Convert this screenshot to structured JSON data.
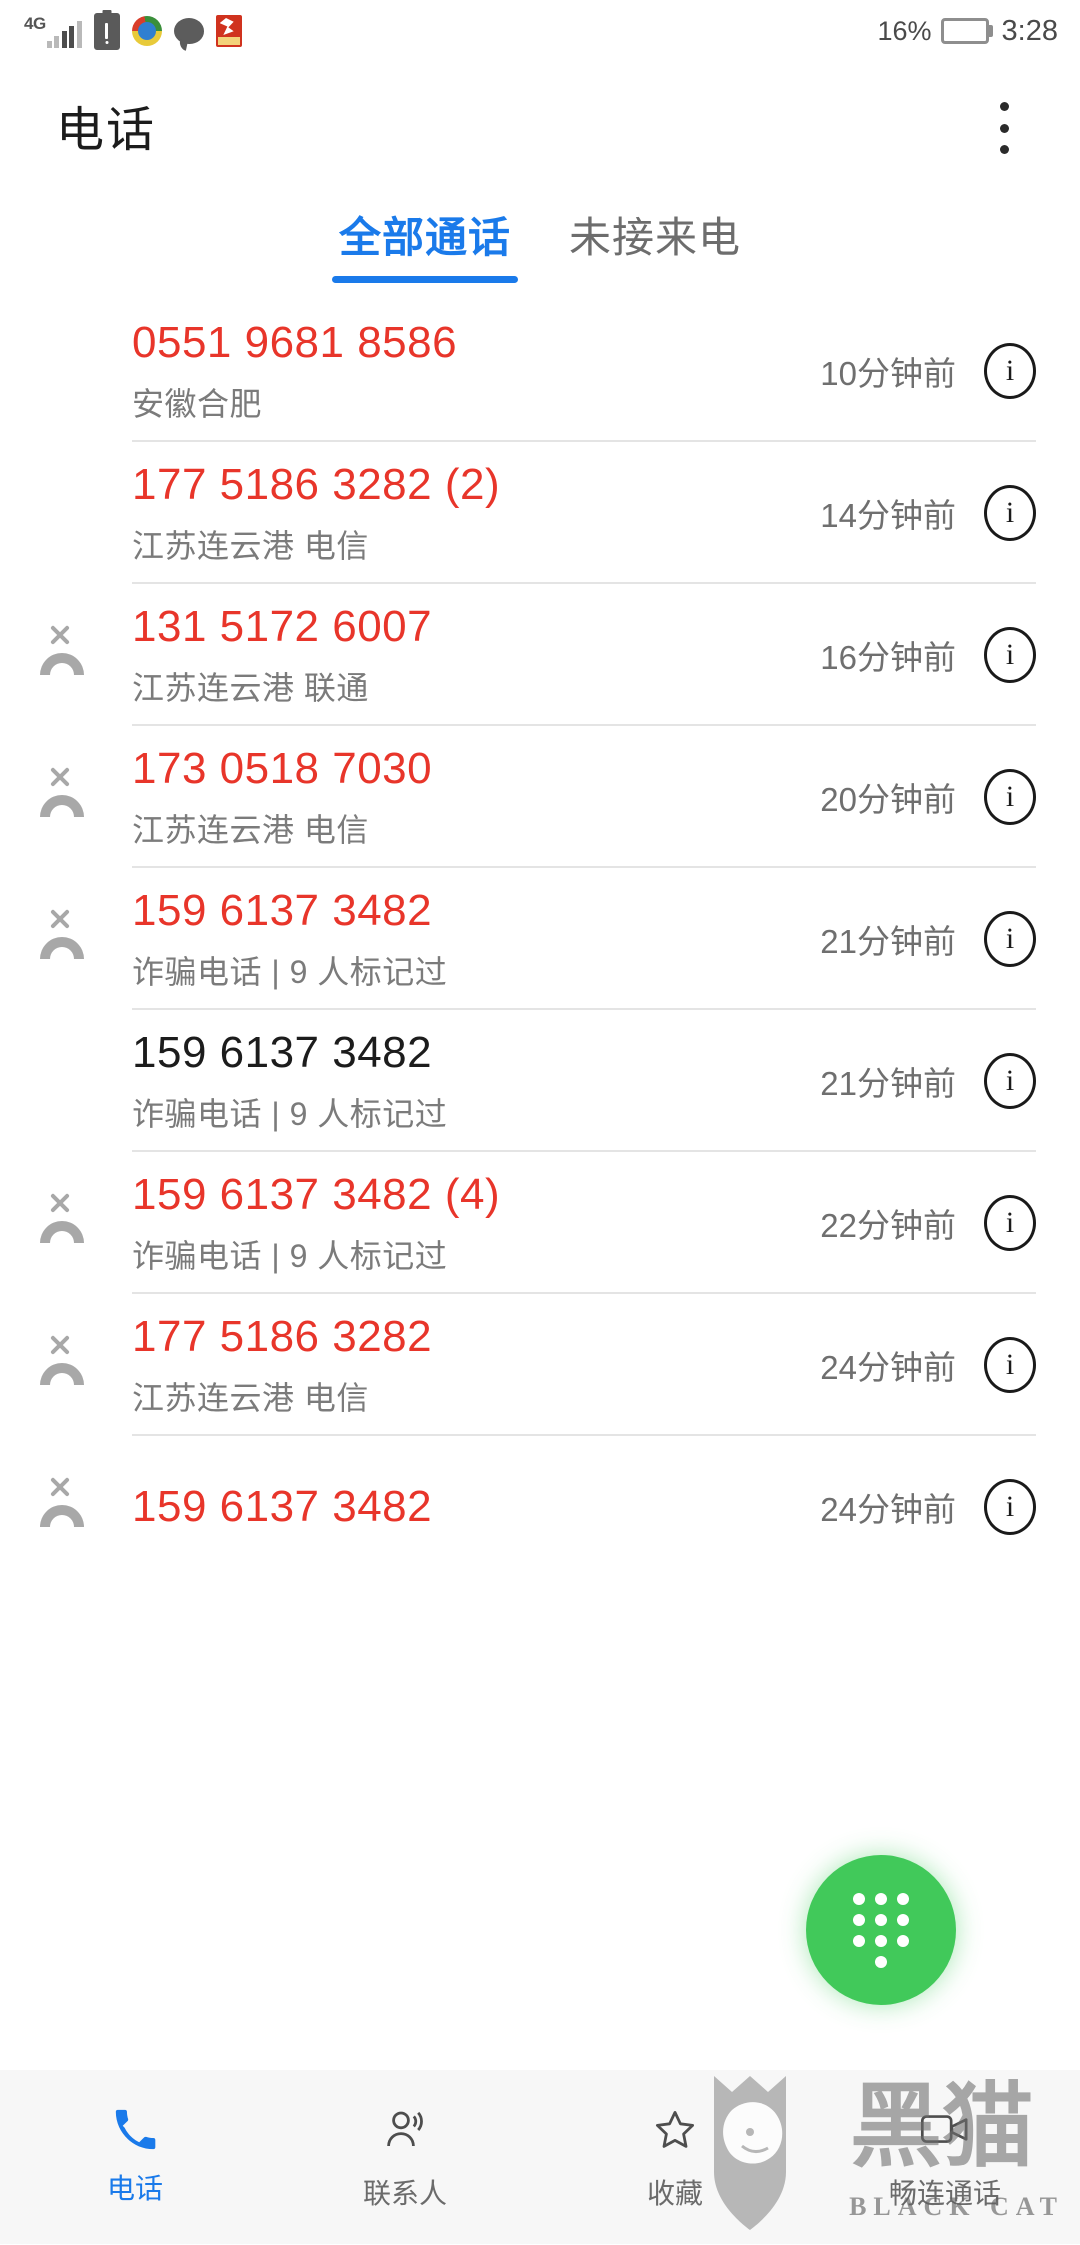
{
  "status_bar": {
    "network": "4G",
    "battery_percent": "16%",
    "battery_level": 16,
    "time": "3:28",
    "icons": [
      "signal-4g-icon",
      "battery-alert-icon",
      "app-circle-icon",
      "chat-bubble-icon",
      "red-app-icon"
    ]
  },
  "app_bar": {
    "title": "电话",
    "overflow_label": "更多"
  },
  "tabs": [
    {
      "label": "全部通话",
      "active": true
    },
    {
      "label": "未接来电",
      "active": false
    }
  ],
  "calls": [
    {
      "number": "0551 9681 8586",
      "subtitle": "安徽合肥",
      "time": "10分钟前",
      "missed": false,
      "red": true
    },
    {
      "number": "177 5186 3282 (2)",
      "subtitle": "江苏连云港 电信",
      "time": "14分钟前",
      "missed": false,
      "red": true
    },
    {
      "number": "131 5172 6007",
      "subtitle": "江苏连云港 联通",
      "time": "16分钟前",
      "missed": true,
      "red": true
    },
    {
      "number": "173 0518 7030",
      "subtitle": "江苏连云港 电信",
      "time": "20分钟前",
      "missed": true,
      "red": true
    },
    {
      "number": "159 6137 3482",
      "subtitle": "诈骗电话 | 9 人标记过",
      "time": "21分钟前",
      "missed": true,
      "red": true
    },
    {
      "number": "159 6137 3482",
      "subtitle": "诈骗电话 | 9 人标记过",
      "time": "21分钟前",
      "missed": false,
      "red": false
    },
    {
      "number": "159 6137 3482 (4)",
      "subtitle": "诈骗电话 | 9 人标记过",
      "time": "22分钟前",
      "missed": true,
      "red": true
    },
    {
      "number": "177 5186 3282",
      "subtitle": "江苏连云港 电信",
      "time": "24分钟前",
      "missed": true,
      "red": true
    },
    {
      "number": "159 6137 3482",
      "subtitle": "",
      "time": "24分钟前",
      "missed": true,
      "red": true
    }
  ],
  "fab": {
    "name": "dialpad-button"
  },
  "bottom_nav": [
    {
      "label": "电话",
      "icon": "phone-icon",
      "active": true
    },
    {
      "label": "联系人",
      "icon": "contacts-icon",
      "active": false
    },
    {
      "label": "收藏",
      "icon": "star-icon",
      "active": false
    },
    {
      "label": "畅连通话",
      "icon": "video-call-icon",
      "active": false
    }
  ],
  "watermark": {
    "text": "BLACK CAT"
  },
  "colors": {
    "accent_blue": "#1a7aea",
    "missed_red": "#e8352a",
    "fab_green": "#41c95a",
    "text_primary": "#1c1c1c",
    "text_secondary": "#7b7b7b",
    "divider": "#e4e4e4",
    "nav_bg": "#f7f7f7",
    "battery_orange": "#f7941e"
  }
}
